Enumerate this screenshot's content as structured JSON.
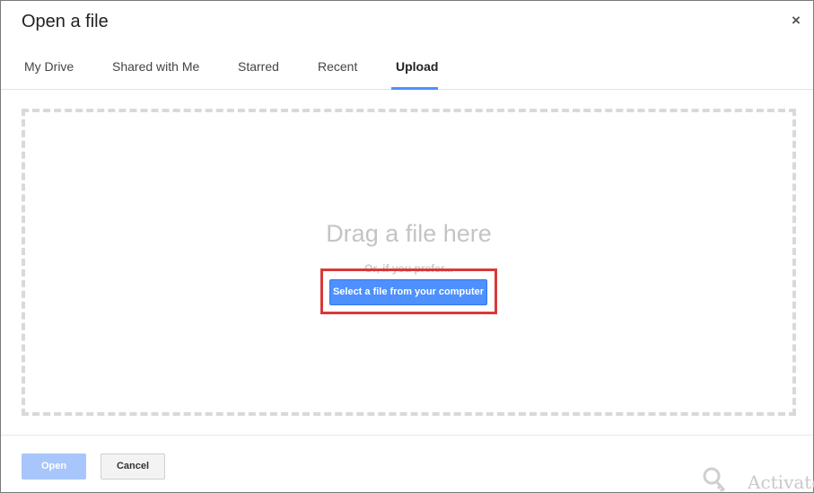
{
  "dialog": {
    "title": "Open a file",
    "close_label": "×"
  },
  "tabs": [
    {
      "label": "My Drive",
      "active": false
    },
    {
      "label": "Shared with Me",
      "active": false
    },
    {
      "label": "Starred",
      "active": false
    },
    {
      "label": "Recent",
      "active": false
    },
    {
      "label": "Upload",
      "active": true
    }
  ],
  "upload": {
    "drag_text": "Drag a file here",
    "prefer_text": "Or, if you prefer...",
    "select_button_label": "Select a file from your computer"
  },
  "footer": {
    "open_label": "Open",
    "cancel_label": "Cancel"
  },
  "watermark": {
    "text": "Activate"
  },
  "colors": {
    "accent": "#4d90fe",
    "highlight": "#d9393a",
    "open_disabled": "#a8c6fb"
  }
}
